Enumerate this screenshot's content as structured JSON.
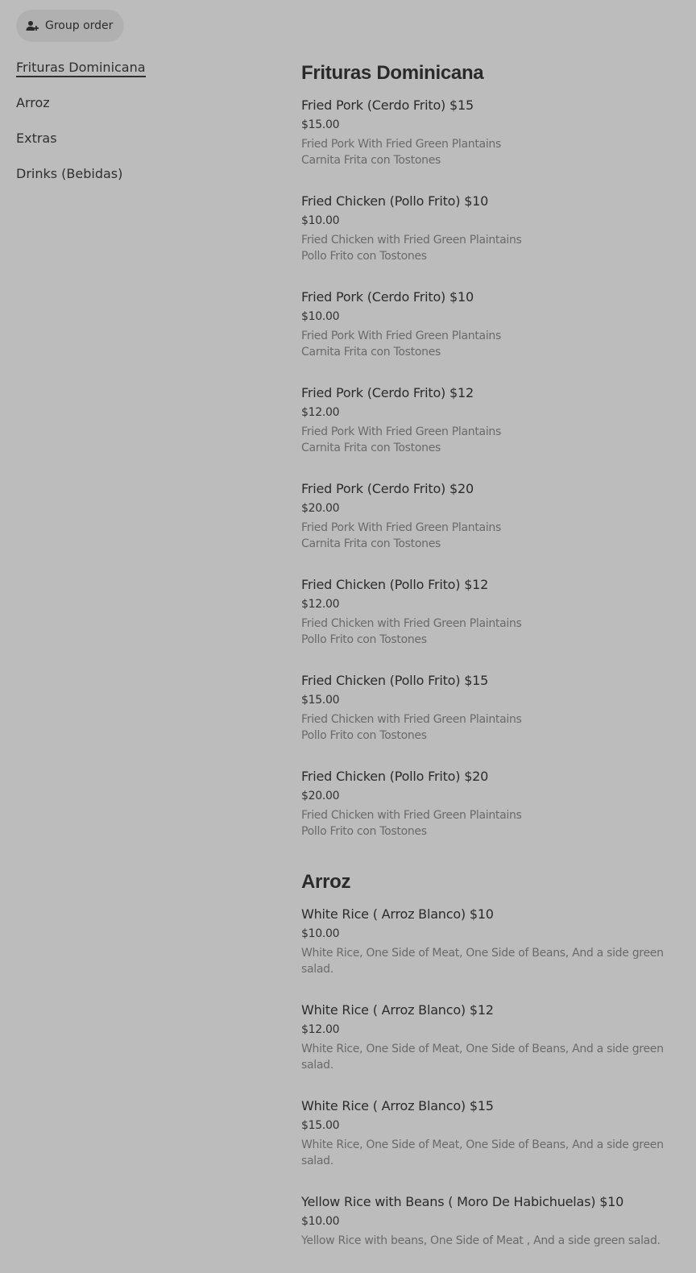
{
  "header": {
    "group_order_label": "Group order"
  },
  "sidebar": {
    "items": [
      {
        "label": "Frituras Dominicana"
      },
      {
        "label": "Arroz"
      },
      {
        "label": "Extras"
      },
      {
        "label": "Drinks (Bebidas)"
      }
    ]
  },
  "sections": [
    {
      "title": "Frituras Dominicana",
      "items": [
        {
          "name": "Fried Pork (Cerdo Frito) $15",
          "price": "$15.00",
          "desc": [
            "Fried Pork With Fried Green Plantains",
            "Carnita Frita con Tostones"
          ]
        },
        {
          "name": "Fried Chicken (Pollo Frito) $10",
          "price": "$10.00",
          "desc": [
            "Fried Chicken with Fried Green Plaintains",
            "Pollo Frito con Tostones"
          ]
        },
        {
          "name": "Fried Pork (Cerdo Frito) $10",
          "price": "$10.00",
          "desc": [
            "Fried Pork With Fried Green Plantains",
            "Carnita Frita con Tostones"
          ]
        },
        {
          "name": "Fried Pork (Cerdo Frito) $12",
          "price": "$12.00",
          "desc": [
            "Fried Pork With Fried Green Plantains",
            "Carnita Frita con Tostones"
          ]
        },
        {
          "name": "Fried Pork (Cerdo Frito) $20",
          "price": "$20.00",
          "desc": [
            "Fried Pork With Fried Green Plantains",
            "Carnita Frita con Tostones"
          ]
        },
        {
          "name": "Fried Chicken (Pollo Frito) $12",
          "price": "$12.00",
          "desc": [
            "Fried Chicken with Fried Green Plaintains",
            "Pollo Frito con Tostones"
          ]
        },
        {
          "name": "Fried Chicken (Pollo Frito) $15",
          "price": "$15.00",
          "desc": [
            "Fried Chicken with Fried Green Plaintains",
            "Pollo Frito con Tostones"
          ]
        },
        {
          "name": "Fried Chicken (Pollo Frito) $20",
          "price": "$20.00",
          "desc": [
            "Fried Chicken with Fried Green Plaintains",
            "Pollo Frito con Tostones"
          ]
        }
      ]
    },
    {
      "title": "Arroz",
      "items": [
        {
          "name": "White Rice ( Arroz Blanco) $10",
          "price": "$10.00",
          "desc": [
            "White Rice, One Side of Meat, One Side of Beans, And a side green salad."
          ]
        },
        {
          "name": "White Rice ( Arroz Blanco) $12",
          "price": "$12.00",
          "desc": [
            "White Rice, One Side of Meat, One Side of Beans, And a side green salad."
          ]
        },
        {
          "name": "White Rice ( Arroz Blanco) $15",
          "price": "$15.00",
          "desc": [
            "White Rice, One Side of Meat, One Side of Beans, And a side green salad."
          ]
        },
        {
          "name": "Yellow Rice with Beans ( Moro De Habichuelas) $10",
          "price": "$10.00",
          "desc": [
            "Yellow Rice with beans, One Side of Meat , And a side green salad."
          ]
        }
      ]
    }
  ]
}
